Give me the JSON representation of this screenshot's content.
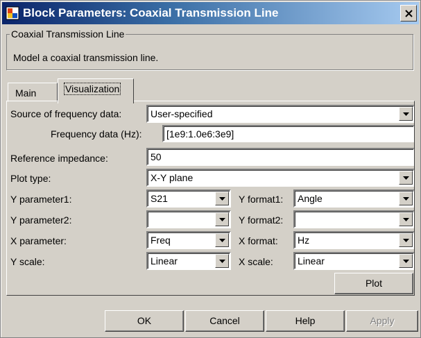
{
  "window": {
    "title": "Block Parameters: Coaxial Transmission Line"
  },
  "description": {
    "group_title": "Coaxial Transmission Line",
    "text": "Model a coaxial transmission line."
  },
  "tabs": {
    "main": "Main",
    "visualization": "Visualization"
  },
  "form": {
    "source_label": "Source of frequency data:",
    "source_value": "User-specified",
    "freq_label": "Frequency data (Hz):",
    "freq_value": "[1e9:1.0e6:3e9]",
    "ref_label": "Reference impedance:",
    "ref_value": "50",
    "plot_type_label": "Plot type:",
    "plot_type_value": "X-Y plane",
    "yparam1_label": "Y parameter1:",
    "yparam1_value": "S21",
    "yformat1_label": "Y format1:",
    "yformat1_value": "Angle",
    "yparam2_label": "Y parameter2:",
    "yparam2_value": "",
    "yformat2_label": "Y format2:",
    "yformat2_value": "",
    "xparam_label": "X parameter:",
    "xparam_value": "Freq",
    "xformat_label": "X format:",
    "xformat_value": "Hz",
    "yscale_label": "Y scale:",
    "yscale_value": "Linear",
    "xscale_label": "X scale:",
    "xscale_value": "Linear"
  },
  "buttons": {
    "plot": "Plot",
    "ok": "OK",
    "cancel": "Cancel",
    "help": "Help",
    "apply": "Apply"
  }
}
